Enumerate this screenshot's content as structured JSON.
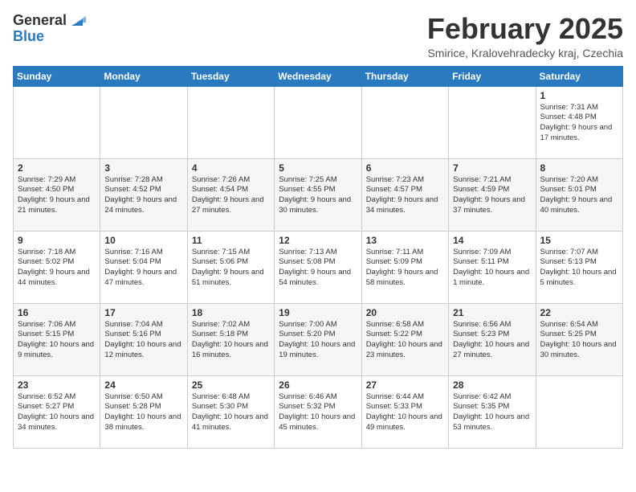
{
  "logo": {
    "general": "General",
    "blue": "Blue"
  },
  "title": "February 2025",
  "subtitle": "Smirice, Kralovehradecky kraj, Czechia",
  "weekdays": [
    "Sunday",
    "Monday",
    "Tuesday",
    "Wednesday",
    "Thursday",
    "Friday",
    "Saturday"
  ],
  "weeks": [
    [
      {
        "day": "",
        "info": ""
      },
      {
        "day": "",
        "info": ""
      },
      {
        "day": "",
        "info": ""
      },
      {
        "day": "",
        "info": ""
      },
      {
        "day": "",
        "info": ""
      },
      {
        "day": "",
        "info": ""
      },
      {
        "day": "1",
        "info": "Sunrise: 7:31 AM\nSunset: 4:48 PM\nDaylight: 9 hours and 17 minutes."
      }
    ],
    [
      {
        "day": "2",
        "info": "Sunrise: 7:29 AM\nSunset: 4:50 PM\nDaylight: 9 hours and 21 minutes."
      },
      {
        "day": "3",
        "info": "Sunrise: 7:28 AM\nSunset: 4:52 PM\nDaylight: 9 hours and 24 minutes."
      },
      {
        "day": "4",
        "info": "Sunrise: 7:26 AM\nSunset: 4:54 PM\nDaylight: 9 hours and 27 minutes."
      },
      {
        "day": "5",
        "info": "Sunrise: 7:25 AM\nSunset: 4:55 PM\nDaylight: 9 hours and 30 minutes."
      },
      {
        "day": "6",
        "info": "Sunrise: 7:23 AM\nSunset: 4:57 PM\nDaylight: 9 hours and 34 minutes."
      },
      {
        "day": "7",
        "info": "Sunrise: 7:21 AM\nSunset: 4:59 PM\nDaylight: 9 hours and 37 minutes."
      },
      {
        "day": "8",
        "info": "Sunrise: 7:20 AM\nSunset: 5:01 PM\nDaylight: 9 hours and 40 minutes."
      }
    ],
    [
      {
        "day": "9",
        "info": "Sunrise: 7:18 AM\nSunset: 5:02 PM\nDaylight: 9 hours and 44 minutes."
      },
      {
        "day": "10",
        "info": "Sunrise: 7:16 AM\nSunset: 5:04 PM\nDaylight: 9 hours and 47 minutes."
      },
      {
        "day": "11",
        "info": "Sunrise: 7:15 AM\nSunset: 5:06 PM\nDaylight: 9 hours and 51 minutes."
      },
      {
        "day": "12",
        "info": "Sunrise: 7:13 AM\nSunset: 5:08 PM\nDaylight: 9 hours and 54 minutes."
      },
      {
        "day": "13",
        "info": "Sunrise: 7:11 AM\nSunset: 5:09 PM\nDaylight: 9 hours and 58 minutes."
      },
      {
        "day": "14",
        "info": "Sunrise: 7:09 AM\nSunset: 5:11 PM\nDaylight: 10 hours and 1 minute."
      },
      {
        "day": "15",
        "info": "Sunrise: 7:07 AM\nSunset: 5:13 PM\nDaylight: 10 hours and 5 minutes."
      }
    ],
    [
      {
        "day": "16",
        "info": "Sunrise: 7:06 AM\nSunset: 5:15 PM\nDaylight: 10 hours and 9 minutes."
      },
      {
        "day": "17",
        "info": "Sunrise: 7:04 AM\nSunset: 5:16 PM\nDaylight: 10 hours and 12 minutes."
      },
      {
        "day": "18",
        "info": "Sunrise: 7:02 AM\nSunset: 5:18 PM\nDaylight: 10 hours and 16 minutes."
      },
      {
        "day": "19",
        "info": "Sunrise: 7:00 AM\nSunset: 5:20 PM\nDaylight: 10 hours and 19 minutes."
      },
      {
        "day": "20",
        "info": "Sunrise: 6:58 AM\nSunset: 5:22 PM\nDaylight: 10 hours and 23 minutes."
      },
      {
        "day": "21",
        "info": "Sunrise: 6:56 AM\nSunset: 5:23 PM\nDaylight: 10 hours and 27 minutes."
      },
      {
        "day": "22",
        "info": "Sunrise: 6:54 AM\nSunset: 5:25 PM\nDaylight: 10 hours and 30 minutes."
      }
    ],
    [
      {
        "day": "23",
        "info": "Sunrise: 6:52 AM\nSunset: 5:27 PM\nDaylight: 10 hours and 34 minutes."
      },
      {
        "day": "24",
        "info": "Sunrise: 6:50 AM\nSunset: 5:28 PM\nDaylight: 10 hours and 38 minutes."
      },
      {
        "day": "25",
        "info": "Sunrise: 6:48 AM\nSunset: 5:30 PM\nDaylight: 10 hours and 41 minutes."
      },
      {
        "day": "26",
        "info": "Sunrise: 6:46 AM\nSunset: 5:32 PM\nDaylight: 10 hours and 45 minutes."
      },
      {
        "day": "27",
        "info": "Sunrise: 6:44 AM\nSunset: 5:33 PM\nDaylight: 10 hours and 49 minutes."
      },
      {
        "day": "28",
        "info": "Sunrise: 6:42 AM\nSunset: 5:35 PM\nDaylight: 10 hours and 53 minutes."
      },
      {
        "day": "",
        "info": ""
      }
    ]
  ]
}
